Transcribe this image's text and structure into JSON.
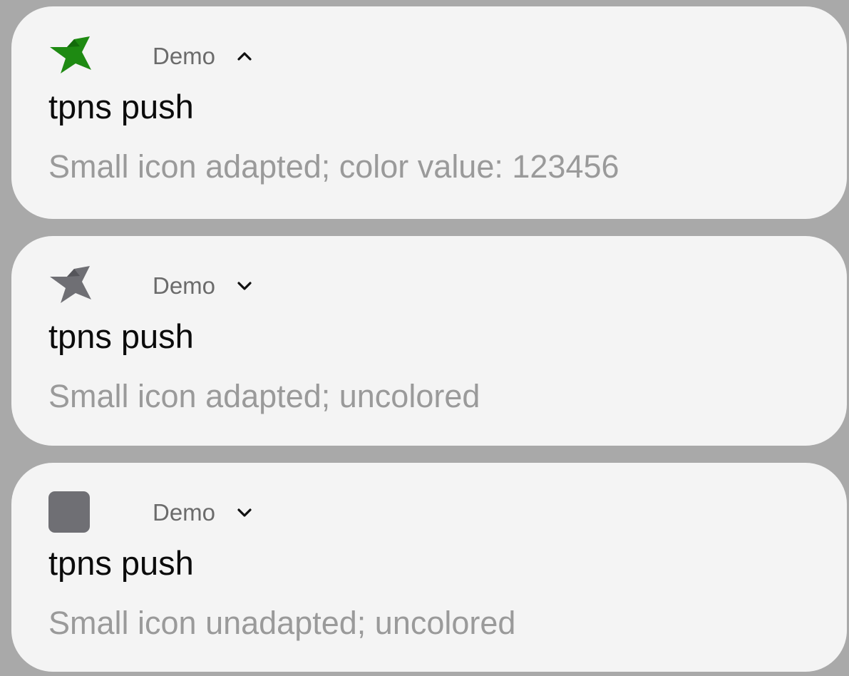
{
  "colors": {
    "background": "#a9a9a9",
    "card": "#f4f4f4",
    "title": "#0b0b0b",
    "app_name": "#6b6b6b",
    "message": "#9a9a9a",
    "icon_green": "#1e8a12",
    "icon_gray": "#6f6f74"
  },
  "notifications": [
    {
      "app_icon": "bird-icon-green",
      "app_name": "Demo",
      "toggle_icon": "chevron-up-icon",
      "title": "tpns push",
      "message": "Small icon adapted; color value: 123456"
    },
    {
      "app_icon": "bird-icon-gray",
      "app_name": "Demo",
      "toggle_icon": "chevron-down-icon",
      "title": "tpns push",
      "message": "Small icon adapted; uncolored"
    },
    {
      "app_icon": "square-icon-gray",
      "app_name": "Demo",
      "toggle_icon": "chevron-down-icon",
      "title": "tpns push",
      "message": "Small icon unadapted; uncolored"
    }
  ]
}
